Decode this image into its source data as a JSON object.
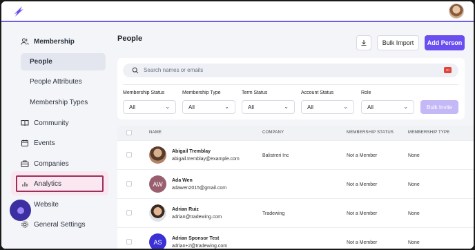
{
  "header": {
    "logo": "brand-logo",
    "avatar": "user-avatar"
  },
  "sidebar": {
    "membership": "Membership",
    "people": "People",
    "people_attributes": "People Attributes",
    "membership_types": "Membership Types",
    "community": "Community",
    "events": "Events",
    "companies": "Companies",
    "analytics": "Analytics",
    "website": "Website",
    "general_settings": "General Settings"
  },
  "main": {
    "title": "People",
    "bulk_import": "Bulk Import",
    "add_person": "Add Person",
    "search_placeholder": "Search names or emails"
  },
  "filters": [
    {
      "label": "Membership Status",
      "value": "All"
    },
    {
      "label": "Membership Type",
      "value": "All"
    },
    {
      "label": "Term Status",
      "value": "All"
    },
    {
      "label": "Account Status",
      "value": "All"
    },
    {
      "label": "Role",
      "value": "All"
    }
  ],
  "bulk_invite": "Bulk Invite",
  "table": {
    "headers": {
      "name": "NAME",
      "company": "COMPANY",
      "membership_status": "MEMBERSHIP STATUS",
      "membership_type": "MEMBERSHIP TYPE"
    },
    "rows": [
      {
        "name": "Abigail Tremblay",
        "email": "abigail.tremblay@example.com",
        "company": "Balistreri Inc",
        "status": "Not a Member",
        "type": "None",
        "initials": ""
      },
      {
        "name": "Ada Wen",
        "email": "adawen2015@gmail.com",
        "company": "",
        "status": "Not a Member",
        "type": "None",
        "initials": "AW"
      },
      {
        "name": "Adrian Ruiz",
        "email": "adrian@tradewing.com",
        "company": "Tradewing",
        "status": "Not a Member",
        "type": "None",
        "initials": ""
      },
      {
        "name": "Adrian Sponsor Test",
        "email": "adrian+2@tradewing.com",
        "company": "",
        "status": "Not a Member",
        "type": "None",
        "initials": "AS"
      }
    ]
  },
  "colors": {
    "accent": "#6a4ff0",
    "topbar_border": "#6f5fe8",
    "highlight": "#9b2f5a",
    "avatar_aw": "#9a5f6f",
    "avatar_as": "#3b2fd6"
  }
}
